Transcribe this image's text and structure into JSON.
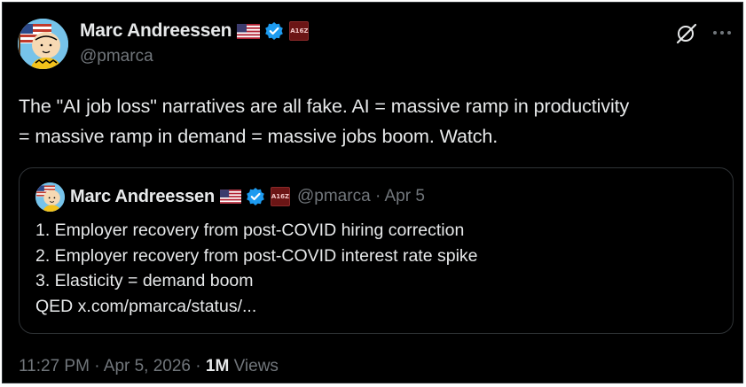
{
  "author": {
    "name": "Marc Andreessen",
    "handle": "@pmarca",
    "flag_icon": "us-flag-icon",
    "verified_icon": "verified-badge-icon",
    "affiliate_badge": "A16Z",
    "avatar_icon": "cartoon-avatar-icon"
  },
  "actions": {
    "grok_icon": "grok-slash-circle-icon",
    "more_icon": "more-options-icon"
  },
  "tweet": {
    "lines": [
      "The \"AI job loss\" narratives are all fake. AI = massive ramp in productivity",
      "= massive ramp in demand = massive jobs boom. Watch."
    ]
  },
  "quote": {
    "name": "Marc Andreessen",
    "handle": "@pmarca",
    "separator": "·",
    "date": "Apr 5",
    "affiliate_badge": "A16Z",
    "lines": [
      "1. Employer recovery from post-COVID hiring correction",
      "2. Employer recovery from post-COVID interest rate spike",
      "3. Elasticity = demand boom",
      "QED x.com/pmarca/status/..."
    ]
  },
  "footer": {
    "time": "11:27 PM",
    "separator": "·",
    "date": "Apr 5, 2026",
    "views_count": "1M",
    "views_label": "Views"
  },
  "colors": {
    "background": "#000000",
    "text_primary": "#e7e9ea",
    "text_secondary": "#71767b",
    "border": "#2f3336",
    "verified_blue": "#1d9bf0"
  }
}
